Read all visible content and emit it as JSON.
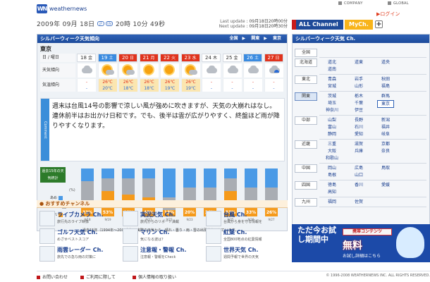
{
  "header": {
    "logo_mark": "WN",
    "logo_text": "weathernews",
    "links": [
      "COMPANY",
      "GLOBAL"
    ],
    "login": "ログイン"
  },
  "datebar": {
    "date": "2009年 09月 18日",
    "pills": [
      "JP",
      "EN"
    ],
    "time": "20時 10分 49秒",
    "last_update_label": "Last update",
    "last_update": "09月18日20時00分",
    "next_update_label": "Next update",
    "next_update": "09月18日20時30分"
  },
  "channel_bar": {
    "all": "ALL Channel",
    "my": "MyCh.",
    "plus": "+"
  },
  "main": {
    "title": "シルバーウィーク天気傾向",
    "breadcrumbs": [
      "全国",
      "関東",
      "東京"
    ],
    "region": "東京",
    "row_labels": [
      "日 / 曜日",
      "天気傾向",
      "気温傾向"
    ],
    "days": [
      {
        "d": "18",
        "w": "金",
        "hi": "-",
        "lo": "-",
        "icon": "cloud",
        "color": "#ffffff"
      },
      {
        "d": "19",
        "w": "土",
        "hi": "26℃",
        "lo": "20℃",
        "icon": "sun-cloud",
        "color": "#3a8be0"
      },
      {
        "d": "20",
        "w": "日",
        "hi": "26℃",
        "lo": "18℃",
        "icon": "sun-cloud",
        "color": "#e0331d"
      },
      {
        "d": "21",
        "w": "月",
        "hi": "26℃",
        "lo": "18℃",
        "icon": "sun",
        "color": "#e0331d"
      },
      {
        "d": "22",
        "w": "火",
        "hi": "26℃",
        "lo": "19℃",
        "icon": "sun",
        "color": "#e0331d"
      },
      {
        "d": "23",
        "w": "水",
        "hi": "26℃",
        "lo": "19℃",
        "icon": "sun-cloud",
        "color": "#e0331d"
      },
      {
        "d": "24",
        "w": "木",
        "hi": "-",
        "lo": "-",
        "icon": "cloud",
        "color": "#ffffff"
      },
      {
        "d": "25",
        "w": "金",
        "hi": "-",
        "lo": "-",
        "icon": "cloud",
        "color": "#ffffff"
      },
      {
        "d": "26",
        "w": "土",
        "hi": "-",
        "lo": "-",
        "icon": "cloud",
        "color": "#3a8be0"
      },
      {
        "d": "27",
        "w": "日",
        "hi": "-",
        "lo": "-",
        "icon": "rain",
        "color": "#e0331d"
      }
    ],
    "comment_tab": "Comment",
    "comment": "週末は台風14号の影響で涼しい風が強めに吹きますが、天気の大崩れはなし。連休前半はお出かけ日和です。でも、後半は雲が広がりやすく、終盤ほど雨が降りやすくなります。"
  },
  "stats": {
    "label": "過去15年の天気統計",
    "legend": [
      "あめ",
      "くもり",
      "はれ"
    ],
    "y_max_label": "(%)",
    "note": "過去15年（1994年〜2008年）の実際の天気から、晴れ・曇り・雨・雪の出現率を示しています。",
    "chart_data": {
      "type": "bar",
      "categories": [
        "9/18",
        "9/19",
        "9/20",
        "9/21",
        "9/22",
        "9/23",
        "9/24",
        "9/25",
        "9/26",
        "9/27"
      ],
      "series": [
        {
          "name": "はれ",
          "values": [
            33,
            53,
            46,
            40,
            13,
            20,
            26,
            53,
            33,
            26
          ]
        },
        {
          "name": "くもり",
          "values": [
            40,
            27,
            34,
            40,
            27,
            40,
            34,
            27,
            27,
            34
          ]
        },
        {
          "name": "あめ",
          "values": [
            27,
            20,
            20,
            20,
            60,
            40,
            40,
            20,
            40,
            40
          ]
        }
      ],
      "colors": {
        "はれ": "#f59a1b",
        "くもり": "#a9adb3",
        "あめ": "#4a9ae6"
      },
      "ylim": [
        0,
        100
      ]
    }
  },
  "recommend": {
    "title": "おすすめチャンネル",
    "items": [
      {
        "title": "ライブカメラ Ch.",
        "sub": "旅行先のライブ映像"
      },
      {
        "title": "実況天気 Ch.",
        "sub": "旅先からのリポート満載"
      },
      {
        "title": "台風 Ch.",
        "sub": "台風から身を守る情報を"
      },
      {
        "title": "ゴルフ天気 Ch.",
        "sub": "めざせベストスコア"
      },
      {
        "title": "マリン Ch.",
        "sub": "気になる波は？"
      },
      {
        "title": "紅葉 Ch.",
        "sub": "全国800地点の紅葉情報"
      },
      {
        "title": "雨雲レーダー Ch.",
        "sub": "旅先での急な雨の対策に"
      },
      {
        "title": "注意報・警報 Ch.",
        "sub": "注意報・警報をCheck"
      },
      {
        "title": "世界天気 Ch.",
        "sub": "週間予報で世界の天気"
      }
    ]
  },
  "sidebar": {
    "title": "シルバーウィーク天気 Ch.",
    "selected_region": "関東",
    "selected_pref": "東京",
    "regions": [
      {
        "name": "全国",
        "prefs": []
      },
      {
        "name": "北海道",
        "prefs": [
          "道北",
          "道東",
          "道央",
          "道南"
        ]
      },
      {
        "name": "東北",
        "prefs": [
          "青森",
          "岩手",
          "秋田",
          "宮城",
          "山形",
          "福島"
        ]
      },
      {
        "name": "関東",
        "prefs": [
          "茨城",
          "栃木",
          "群馬",
          "埼玉",
          "千葉",
          "東京",
          "神奈川",
          "伊豆"
        ]
      },
      {
        "name": "中部",
        "prefs": [
          "山梨",
          "長野",
          "新潟",
          "富山",
          "石川",
          "福井",
          "静岡",
          "愛知",
          "岐阜"
        ]
      },
      {
        "name": "近畿",
        "prefs": [
          "三重",
          "滋賀",
          "京都",
          "大阪",
          "兵庫",
          "奈良",
          "和歌山"
        ]
      },
      {
        "name": "中国",
        "prefs": [
          "岡山",
          "広島",
          "鳥取",
          "島根",
          "山口"
        ]
      },
      {
        "name": "四国",
        "prefs": [
          "徳島",
          "香川",
          "愛媛",
          "高知"
        ]
      },
      {
        "name": "九州",
        "prefs": [
          "福岡",
          "佐賀"
        ]
      }
    ]
  },
  "ad": {
    "big": "ただ今お試し期間中",
    "tag": "携帯コンテンツ",
    "free": "無料",
    "link": "お試し詳細はこちら"
  },
  "footer": {
    "links": [
      "お問い合わせ",
      "ご利用に際して",
      "個人情報の取り扱い"
    ],
    "copyright": "© 1996-2008 WEATHERNEWS INC. ALL RIGHTS RESERVED."
  }
}
